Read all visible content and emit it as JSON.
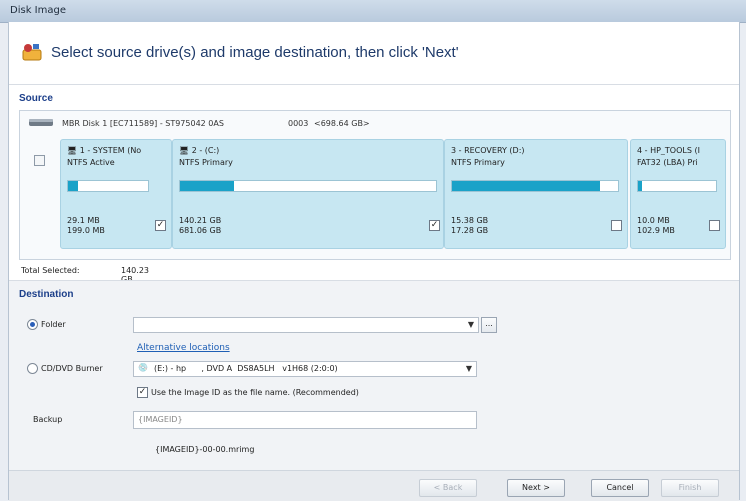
{
  "window": {
    "title": "Disk Image"
  },
  "header": {
    "title": "Select source drive(s) and image destination, then click 'Next'"
  },
  "source": {
    "label": "Source",
    "disk_info": "MBR Disk 1 [EC711589] - ST975042 0AS",
    "disk_id": "0003",
    "disk_size": "<698.64 GB>",
    "partitions": [
      {
        "name": "1 - SYSTEM (No",
        "fs": "NTFS Active",
        "used": "29.1 MB",
        "total": "199.0 MB",
        "fill": 0.12,
        "checked": true,
        "check_glyph": "✓"
      },
      {
        "name": "2 - (C:)",
        "fs": "NTFS Primary",
        "used": "140.21 GB",
        "total": "681.06 GB",
        "fill": 0.21,
        "checked": true,
        "check_glyph": "✓"
      },
      {
        "name": "3 - RECOVERY (D:)",
        "fs": "NTFS Primary",
        "used": "15.38 GB",
        "total": "17.28 GB",
        "fill": 0.89,
        "checked": false,
        "check_glyph": ""
      },
      {
        "name": "4 - HP_TOOLS (I",
        "fs": "FAT32 (LBA) Pri",
        "used": "10.0 MB",
        "total": "102.9 MB",
        "fill": 0.05,
        "checked": false,
        "check_glyph": ""
      }
    ],
    "total_selected_label": "Total Selected:",
    "total_selected_value": "140.23 GB"
  },
  "destination": {
    "label": "Destination",
    "folder_label": "Folder",
    "folder_value": "",
    "browse_label": "...",
    "alt_locations": "Alternative locations",
    "burner_label": "CD/DVD Burner",
    "burner_value": "(E:) - hp      , DVD A  DS8A5LH   v1H68 (2:0:0)",
    "use_id_label": "Use the Image ID as the file name.  (Recommended)",
    "use_id_glyph": "✓",
    "backup_label": "Backup",
    "backup_value": "{IMAGEID}",
    "filename_preview": "{IMAGEID}-00-00.mrimg"
  },
  "footer": {
    "back": "< Back",
    "next": "Next >",
    "cancel": "Cancel",
    "finish": "Finish"
  }
}
